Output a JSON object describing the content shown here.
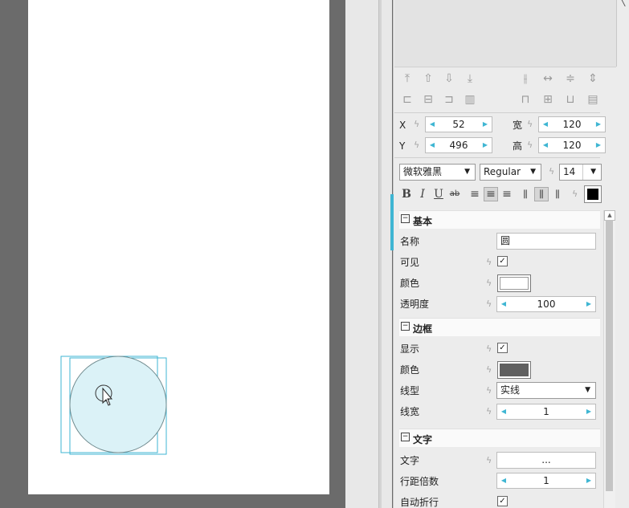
{
  "shape": {
    "name": "圆",
    "fill": "#dbf2f7",
    "stroke": "#6f8a8e",
    "selection_color": "#3fb6d3"
  },
  "position": {
    "x_label": "X",
    "x": "52",
    "y_label": "Y",
    "y": "496",
    "w_label": "宽",
    "w": "120",
    "h_label": "高",
    "h": "120"
  },
  "font": {
    "family": "微软雅黑",
    "style": "Regular",
    "size": "14",
    "color": "#000000"
  },
  "format_buttons": {
    "bold": "B",
    "italic": "I",
    "underline": "U",
    "strike": "ab"
  },
  "basic": {
    "header": "基本",
    "name_label": "名称",
    "name_value": "圆",
    "visible_label": "可见",
    "color_label": "颜色",
    "color_value": "#ffffff",
    "opacity_label": "透明度",
    "opacity_value": "100"
  },
  "border": {
    "header": "边框",
    "show_label": "显示",
    "color_label": "颜色",
    "color_value": "#606060",
    "style_label": "线型",
    "style_value": "实线",
    "width_label": "线宽",
    "width_value": "1"
  },
  "text": {
    "header": "文字",
    "text_label": "文字",
    "text_value": "...",
    "line_height_label": "行距倍数",
    "line_height_value": "1",
    "wrap_label": "自动折行"
  },
  "toggle_symbol": "⊟"
}
